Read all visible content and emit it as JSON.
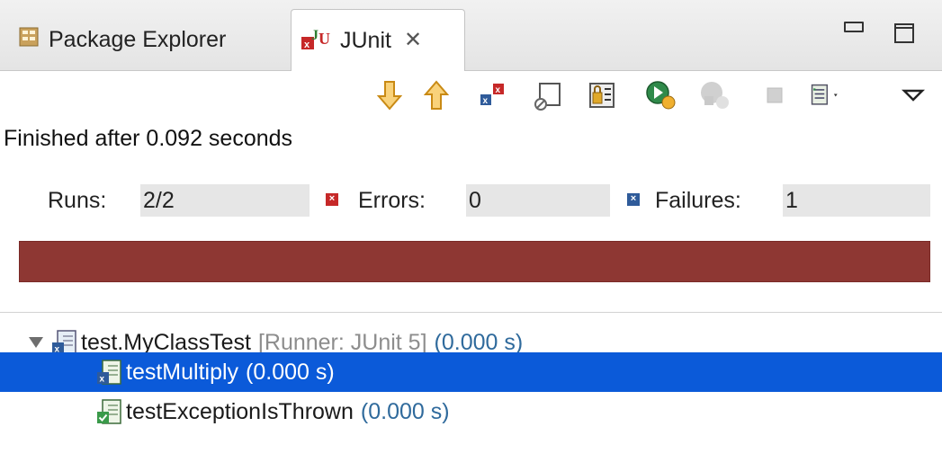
{
  "tabs": {
    "package_explorer": "Package Explorer",
    "junit": "JUnit",
    "close_glyph": "✕"
  },
  "toolbar_icons": [
    "next-failure-icon",
    "previous-failure-icon",
    "show-failures-only-icon",
    "scroll-lock-icon",
    "show-skipped-icon",
    "rerun-icon",
    "rerun-failed-first-icon",
    "stop-icon",
    "test-run-history-icon",
    "view-menu-icon"
  ],
  "status": "Finished after 0.092 seconds",
  "counters": {
    "runs_label": "Runs:",
    "runs_value": "2/2",
    "errors_label": "Errors:",
    "errors_value": "0",
    "failures_label": "Failures:",
    "failures_value": "1"
  },
  "progress": {
    "fraction": 1.0,
    "color": "#8e3733"
  },
  "tree": {
    "suite": {
      "name": "test.MyClassTest",
      "runner": "[Runner: JUnit 5]",
      "time": "(0.000 s)"
    },
    "tests": [
      {
        "name": "testMultiply",
        "time": "(0.000 s)",
        "status": "failure",
        "selected": true
      },
      {
        "name": "testExceptionIsThrown",
        "time": "(0.000 s)",
        "status": "passed",
        "selected": false
      }
    ]
  },
  "colors": {
    "selection": "#0b5ad9",
    "failure_bar": "#8e3733",
    "time_text": "#2f6a9c"
  }
}
